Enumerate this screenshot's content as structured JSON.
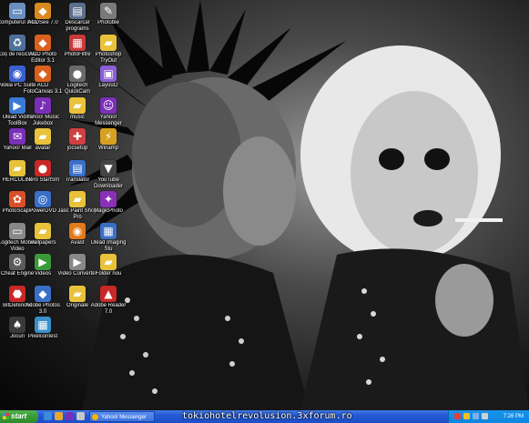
{
  "desktop": {
    "icons": [
      {
        "name": "icon-my-computer",
        "label": "Computerul meu",
        "glyph": "▭",
        "color": "#6a8fbf"
      },
      {
        "name": "icon-acdsee",
        "label": "ACDSee 7.0",
        "glyph": "◆",
        "color": "#d98a1f"
      },
      {
        "name": "icon-downloaded-programs",
        "label": "Descarcar programs",
        "glyph": "▤",
        "color": "#5c6f8c"
      },
      {
        "name": "icon-photobie",
        "label": "Photobie",
        "glyph": "✎",
        "color": "#7a7a7a"
      },
      {
        "name": "icon-recycle-bin",
        "label": "Coș de reciclare",
        "glyph": "♻",
        "color": "#4f6f9a"
      },
      {
        "name": "icon-acd-photo-editor",
        "label": "ACD Photo Editor 3.1",
        "glyph": "◆",
        "color": "#d9601f"
      },
      {
        "name": "icon-photofiltre",
        "label": "PhotoFiltre",
        "glyph": "▦",
        "color": "#c83a3a"
      },
      {
        "name": "icon-photoshop",
        "label": "Photoshop TryOut",
        "glyph": "▰",
        "color": "#e8c23a"
      },
      {
        "name": "icon-nokia-pc-suite",
        "label": "Nokia PC Suite",
        "glyph": "◉",
        "color": "#3a5fcf"
      },
      {
        "name": "icon-acd-foto-canvas",
        "label": "ACD FotoCanvas 3.1",
        "glyph": "◆",
        "color": "#d9601f"
      },
      {
        "name": "icon-quickcam",
        "label": "Logitech QuickCam",
        "glyph": "●",
        "color": "#6a6a6a"
      },
      {
        "name": "icon-layout2",
        "label": "Layout2",
        "glyph": "▣",
        "color": "#8a5fd6"
      },
      {
        "name": "icon-ulead-video",
        "label": "Ulead Video ToolBox",
        "glyph": "▶",
        "color": "#3a7ad6"
      },
      {
        "name": "icon-yahoo-music",
        "label": "Yahoo! Music Jukebox",
        "glyph": "♪",
        "color": "#7a2fb8"
      },
      {
        "name": "icon-music-folder",
        "label": "music",
        "glyph": "▰",
        "color": "#e8c23a"
      },
      {
        "name": "icon-yahoo-messenger",
        "label": "Yahoo! Messenger",
        "glyph": "☺",
        "color": "#7a2fb8"
      },
      {
        "name": "icon-yahoo-mail",
        "label": "Yahoo! Mail",
        "glyph": "✉",
        "color": "#7a2fb8"
      },
      {
        "name": "icon-avatar-folder",
        "label": "avatar",
        "glyph": "▰",
        "color": "#e8c23a"
      },
      {
        "name": "icon-jigsaw",
        "label": "jocsetup",
        "glyph": "✚",
        "color": "#d04040"
      },
      {
        "name": "icon-winamp",
        "label": "Winamp",
        "glyph": "⚡",
        "color": "#d8a020"
      },
      {
        "name": "icon-hercules-folder",
        "label": "HERCULES",
        "glyph": "▰",
        "color": "#e8c23a"
      },
      {
        "name": "icon-nero",
        "label": "Nero StartSm",
        "glyph": "●",
        "color": "#c82828"
      },
      {
        "name": "icon-translator",
        "label": "Translator",
        "glyph": "▤",
        "color": "#3a6fc8"
      },
      {
        "name": "icon-youtube-downloader",
        "label": "YouTube Downloader",
        "glyph": "▼",
        "color": "#444"
      },
      {
        "name": "icon-photoscape",
        "label": "PhotoScape",
        "glyph": "✿",
        "color": "#d8502a"
      },
      {
        "name": "icon-power-dvd",
        "label": "PowerDVD",
        "glyph": "◎",
        "color": "#3a6fc8"
      },
      {
        "name": "icon-jasc-paint-shop",
        "label": "Jasc Paint Shop Pro",
        "glyph": "▰",
        "color": "#e8c23a"
      },
      {
        "name": "icon-magicphoto",
        "label": "MagicPhoto",
        "glyph": "✦",
        "color": "#8a2fb8"
      },
      {
        "name": "icon-logitech-mobile",
        "label": "Logitech Mobile Video",
        "glyph": "▭",
        "color": "#888"
      },
      {
        "name": "icon-wallpapers-folder",
        "label": "wallpapers",
        "glyph": "▰",
        "color": "#e8c23a"
      },
      {
        "name": "icon-avast",
        "label": "Avast",
        "glyph": "◉",
        "color": "#e07a1a"
      },
      {
        "name": "icon-imaging",
        "label": "Ulead Imaging Stu",
        "glyph": "▦",
        "color": "#3a6fc8"
      },
      {
        "name": "icon-cheat-engine",
        "label": "Cheat Engine",
        "glyph": "⚙",
        "color": "#5a5a5a"
      },
      {
        "name": "icon-videos",
        "label": "Videos",
        "glyph": "▶",
        "color": "#3a9a3a"
      },
      {
        "name": "icon-video-converter",
        "label": "Video Converter",
        "glyph": "▶",
        "color": "#888"
      },
      {
        "name": "icon-folder-nou",
        "label": "Folder nou",
        "glyph": "▰",
        "color": "#e8c23a"
      },
      {
        "name": "icon-bitdefender",
        "label": "BitDefender",
        "glyph": "⬣",
        "color": "#c82828"
      },
      {
        "name": "icon-picasa",
        "label": "Adobe Photos 3.0",
        "glyph": "◆",
        "color": "#3a6fc8"
      },
      {
        "name": "icon-originals-folder",
        "label": "Originale",
        "glyph": "▰",
        "color": "#e8c23a"
      },
      {
        "name": "icon-adobe-reader",
        "label": "Adobe Reader 7.0",
        "glyph": "▲",
        "color": "#c82828"
      },
      {
        "name": "icon-games",
        "label": "Jocuri",
        "glyph": "♠",
        "color": "#3a3a3a"
      },
      {
        "name": "icon-pixelcontest",
        "label": "Pixelcontest",
        "glyph": "▦",
        "color": "#3a8fc8"
      }
    ]
  },
  "taskbar": {
    "start_label": "start",
    "task_button_label": "Yahoo! Messenger",
    "clock": "7:26 PM"
  },
  "watermark": "tokiohotelrevolusion.3xforum.ro"
}
